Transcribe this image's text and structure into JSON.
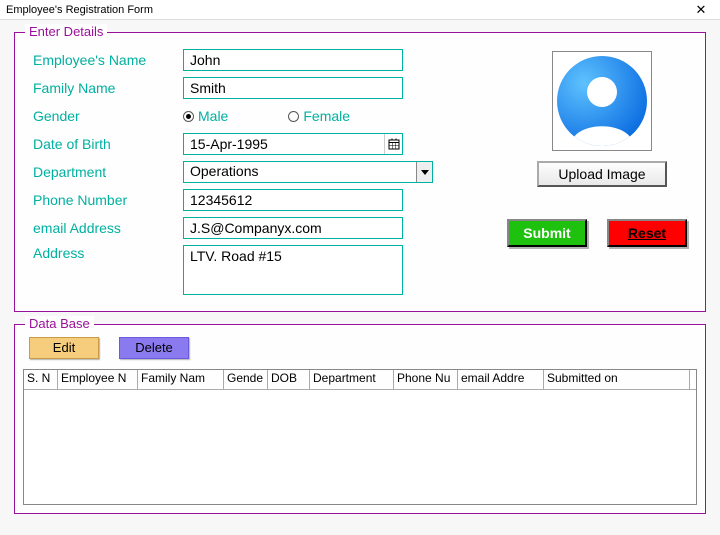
{
  "window": {
    "title": "Employee's Registration Form",
    "close": "✕"
  },
  "groups": {
    "enter": "Enter Details",
    "db": "Data Base"
  },
  "labels": {
    "name": "Employee's Name",
    "family": "Family Name",
    "gender": "Gender",
    "dob": "Date of Birth",
    "dept": "Department",
    "phone": "Phone Number",
    "email": "email Address",
    "address": "Address"
  },
  "values": {
    "name": "John",
    "family": "Smith",
    "dob": "15-Apr-1995",
    "dept": "Operations",
    "phone": "12345612",
    "email": "J.S@Companyx.com",
    "address": "LTV. Road #15"
  },
  "gender": {
    "male": "Male",
    "female": "Female",
    "selected": "male"
  },
  "buttons": {
    "upload": "Upload Image",
    "submit": "Submit",
    "reset": "Reset",
    "edit": "Edit",
    "delete": "Delete"
  },
  "grid_headers": [
    "S. N",
    "Employee N",
    "Family Nam",
    "Gende",
    "DOB",
    "Department",
    "Phone Nu",
    "email Addre",
    "Submitted on"
  ],
  "grid_widths": [
    34,
    80,
    86,
    44,
    42,
    84,
    64,
    86,
    146
  ]
}
